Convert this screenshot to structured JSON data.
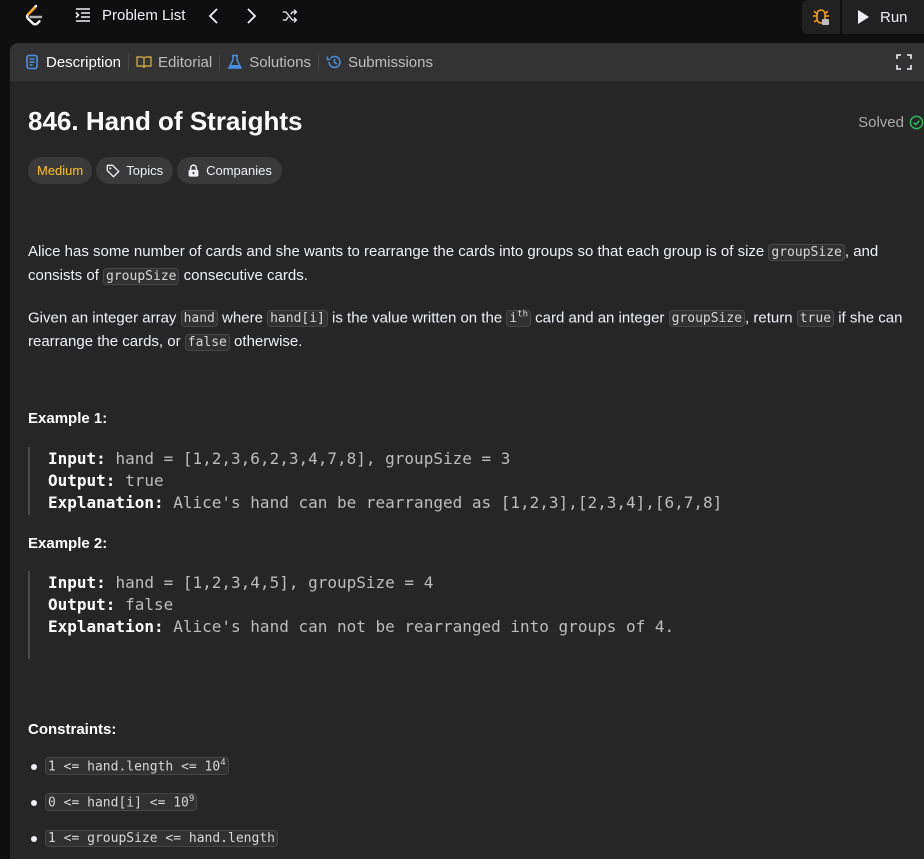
{
  "nav": {
    "problem_list_label": "Problem List",
    "run_label": "Run"
  },
  "tabs": [
    {
      "label": "Description",
      "icon": "description-icon",
      "color": "#4a90e2"
    },
    {
      "label": "Editorial",
      "icon": "book-icon",
      "color": "#c8a040"
    },
    {
      "label": "Solutions",
      "icon": "flask-icon",
      "color": "#4a90e2"
    },
    {
      "label": "Submissions",
      "icon": "history-icon",
      "color": "#4a90e2"
    }
  ],
  "problem": {
    "title": "846. Hand of Straights",
    "status": "Solved",
    "difficulty": "Medium",
    "topics_label": "Topics",
    "companies_label": "Companies",
    "p1": {
      "t1": "Alice has some number of cards and she wants to rearrange the cards into groups so that each group is of size ",
      "c1": "groupSize",
      "t2": ", and consists of ",
      "c2": "groupSize",
      "t3": " consecutive cards."
    },
    "p2": {
      "t1": "Given an integer array ",
      "c1": "hand",
      "t2": " where ",
      "c2": "hand[i]",
      "t3": " is the value written on the ",
      "c3_base": "i",
      "c3_sup": "th",
      "t4": " card and an integer ",
      "c4": "groupSize",
      "t5": ", return ",
      "c5": "true",
      "t6": " if she can rearrange the cards, or ",
      "c6": "false",
      "t7": " otherwise."
    },
    "examples": [
      {
        "title": "Example 1:",
        "input_label": "Input:",
        "input": "hand = [1,2,3,6,2,3,4,7,8], groupSize = 3",
        "output_label": "Output:",
        "output": "true",
        "explanation_label": "Explanation:",
        "explanation": "Alice's hand can be rearranged as [1,2,3],[2,3,4],[6,7,8]"
      },
      {
        "title": "Example 2:",
        "input_label": "Input:",
        "input": "hand = [1,2,3,4,5], groupSize = 4",
        "output_label": "Output:",
        "output": "false",
        "explanation_label": "Explanation:",
        "explanation": "Alice's hand can not be rearranged into groups of 4."
      }
    ],
    "constraints_title": "Constraints:",
    "constraints": [
      {
        "base": "1 <= hand.length <= 10",
        "sup": "4"
      },
      {
        "base": "0 <= hand[i] <= 10",
        "sup": "9"
      },
      {
        "base": "1 <= groupSize <= hand.length",
        "sup": ""
      }
    ]
  }
}
